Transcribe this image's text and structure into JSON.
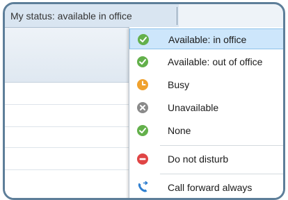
{
  "status_bar": {
    "text": "My status: available in office"
  },
  "status_menu": {
    "items": [
      {
        "label": "Available: in office",
        "icon": "check-circle-icon",
        "color": "#63b04b",
        "selected": true
      },
      {
        "label": "Available: out of office",
        "icon": "check-circle-icon",
        "color": "#63b04b"
      },
      {
        "label": "Busy",
        "icon": "clock-icon",
        "color": "#f0a12d"
      },
      {
        "label": "Unavailable",
        "icon": "x-circle-icon",
        "color": "#8a8a8a"
      },
      {
        "label": "None",
        "icon": "check-circle-icon",
        "color": "#63b04b"
      },
      {
        "label": "Do not disturb",
        "icon": "minus-circle-icon",
        "color": "#e04545"
      },
      {
        "label": "Call forward always",
        "icon": "phone-forward-icon",
        "color": "#2f7fd0"
      }
    ]
  },
  "colors": {
    "selection": "#cde6fb",
    "frame": "#5d7e99"
  }
}
